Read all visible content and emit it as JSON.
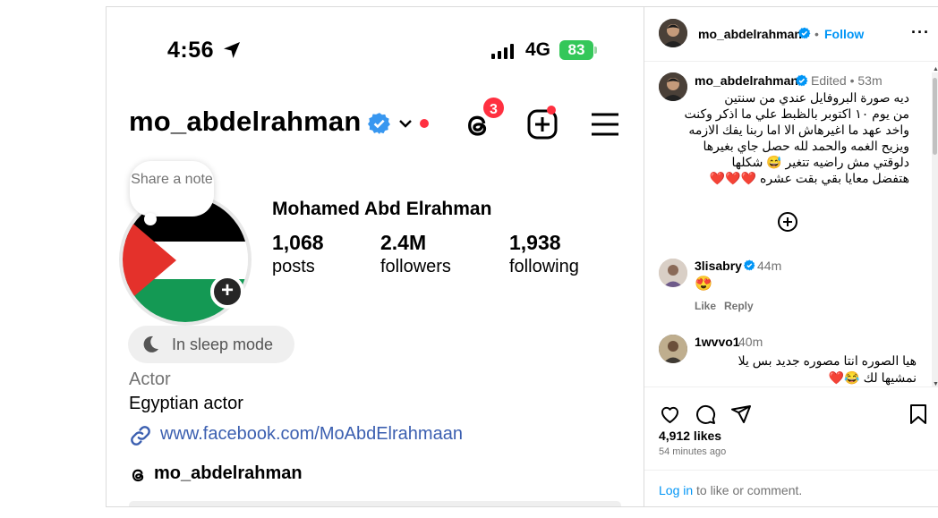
{
  "phone": {
    "status_time": "4:56",
    "network": "4G",
    "battery": "83",
    "username": "mo_abdelrahman",
    "threads_badge_count": "3",
    "note_text": "Share a note",
    "full_name": "Mohamed Abd Elrahman",
    "stats": [
      {
        "num": "1,068",
        "label": "posts"
      },
      {
        "num": "2.4M",
        "label": "followers"
      },
      {
        "num": "1,938",
        "label": "following"
      }
    ],
    "sleep_mode": "In sleep mode",
    "category": "Actor",
    "bio": "Egyptian actor",
    "link": "www.facebook.com/MoAbdElrahmaan",
    "threads_handle": "mo_abdelrahman"
  },
  "panel": {
    "header": {
      "username": "mo_abdelrahman",
      "dot": "•",
      "follow": "Follow",
      "more": "···"
    },
    "caption": {
      "username": "mo_abdelrahman",
      "edited": "Edited • 53m",
      "lines": [
        "ديه صورة البروفايل عندي من سنتين",
        "من يوم ١٠ اكتوبر بالظبط علي ما اذكر وكنت",
        "واخد عهد ما اغيرهاش الا اما ربنا يفك الازمه",
        "ويزيح الغمه والحمد لله حصل جاي بغيرها",
        "دلوقتي مش راضيه تتغير 😅 شكلها",
        "هتفضل معايا بقي بقت عشره"
      ],
      "hearts": "❤️❤️❤️"
    },
    "comments": [
      {
        "username": "3lisabry",
        "time": "44m",
        "text": "😍",
        "like": "Like",
        "reply": "Reply"
      },
      {
        "username": "1wvvo1",
        "time": "40m",
        "line1": "هيا الصوره انتا مصوره جديد بس يلا",
        "line2": "نمشيها لك 😂❤️"
      }
    ],
    "likes": "4,912 likes",
    "ago": "54 minutes ago",
    "login_link": "Log in",
    "login_rest": "to like or comment."
  },
  "colors": {
    "accent": "#0095f6",
    "notification": "#ff3040",
    "battery": "#34c759",
    "link": "#3b5fb0"
  },
  "icons": [
    "location-arrow-icon",
    "signal-icon",
    "verified-icon",
    "chevron-down-icon",
    "threads-icon",
    "new-post-icon",
    "menu-icon",
    "moon-icon",
    "link-icon",
    "add-circle-icon",
    "heart-icon",
    "comment-icon",
    "share-icon",
    "bookmark-icon"
  ]
}
